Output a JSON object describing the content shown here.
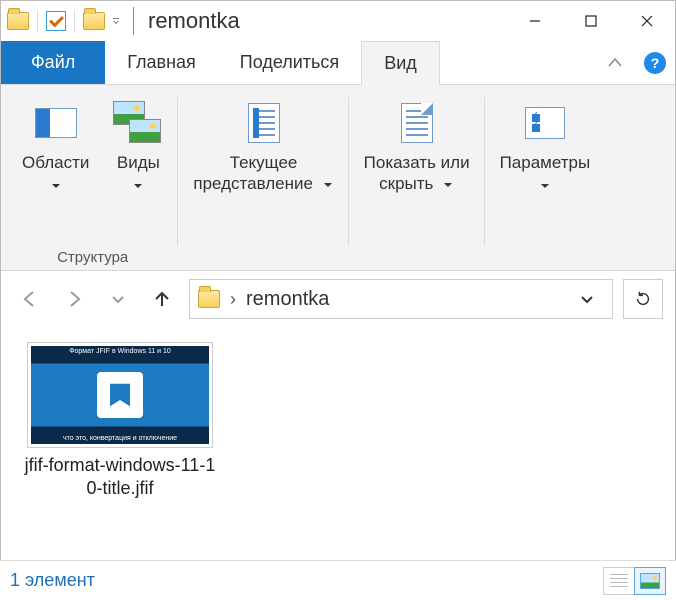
{
  "title": "remontka",
  "tabs": {
    "file": "Файл",
    "home": "Главная",
    "share": "Поделиться",
    "view": "Вид"
  },
  "ribbon": {
    "panes_label": "Области",
    "layouts_label": "Виды",
    "layout_group_footer": "Структура",
    "current_view_line1": "Текущее",
    "current_view_line2": "представление",
    "show_hide_line1": "Показать или",
    "show_hide_line2": "скрыть",
    "options_label": "Параметры"
  },
  "breadcrumb": {
    "folder": "remontka"
  },
  "files": [
    {
      "name": "jfif-format-windows-11-10-title.jfif",
      "thumb_top": "Формат JFIF в Windows 11 и 10",
      "thumb_bottom": "что это, конвертация и отключение"
    }
  ],
  "status": {
    "count_text": "1 элемент"
  },
  "help_glyph": "?"
}
